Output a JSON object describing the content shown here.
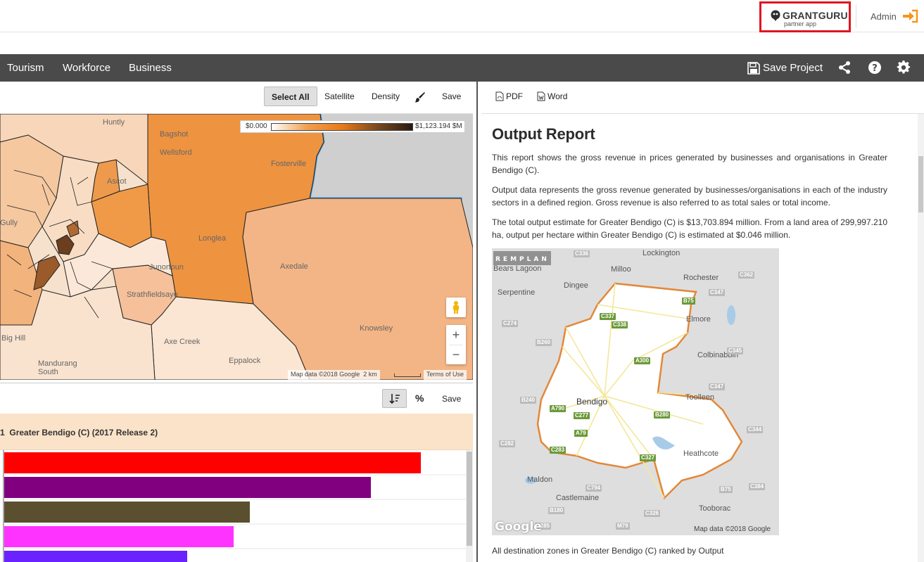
{
  "header": {
    "logo_name": "GRANTGURU",
    "logo_sub": "partner app",
    "user": "Admin",
    "brand_color": "#e0161e",
    "accent_color": "#f7941d"
  },
  "nav": {
    "items": [
      "Tourism",
      "Workforce",
      "Business"
    ],
    "save_project": "Save Project"
  },
  "map_toolbar": {
    "select_all": "Select All",
    "satellite": "Satellite",
    "density": "Density",
    "save": "Save"
  },
  "map": {
    "legend_min": "$0.000",
    "legend_max": "$1,123.194 $M",
    "places": [
      {
        "name": "Huntly"
      },
      {
        "name": "Bagshot"
      },
      {
        "name": "Wellsford"
      },
      {
        "name": "Fosterville"
      },
      {
        "name": "Gully"
      },
      {
        "name": "Longlea"
      },
      {
        "name": "Junortoun"
      },
      {
        "name": "Axedale"
      },
      {
        "name": "Strathfieldsaye"
      },
      {
        "name": "Knowsley"
      },
      {
        "name": "Axe Creek"
      },
      {
        "name": "Big Hill"
      },
      {
        "name": "Eppalock"
      },
      {
        "name": "Mandurang South"
      },
      {
        "name": "Ascot"
      }
    ],
    "attribution": "Map data ©2018 Google",
    "scale": "2 km",
    "terms": "Terms of Use"
  },
  "chart_toolbar": {
    "pct": "%",
    "save": "Save"
  },
  "chart_data": {
    "type": "bar",
    "title": "Greater Bendigo (C) (2017 Release 2)",
    "title_prefix": "1",
    "orientation": "horizontal",
    "series": [
      {
        "values": [
          1,
          0.88,
          0.59,
          0.55,
          0.44
        ],
        "colors": [
          "#ff0000",
          "#800080",
          "#5a5030",
          "#ff33ff",
          "#6a22ff"
        ]
      }
    ]
  },
  "doc_toolbar": {
    "pdf": "PDF",
    "word": "Word"
  },
  "report": {
    "title": "Output Report",
    "p1": "This report shows the gross revenue in prices generated by businesses and organisations in Greater Bendigo (C).",
    "p2": "Output data represents the gross revenue generated by businesses/organisations in each of the industry sectors in a defined region. Gross revenue is also referred to as total sales or total income.",
    "p3": "The total output estimate for Greater Bendigo (C) is $13,703.894 million. From a land area of 299,997.210 ha, output per hectare within Greater Bendigo (C) is estimated at $0.046 million.",
    "caption": "All  destination zones in Greater Bendigo (C) ranked by Output",
    "map_watermark": "REMPLAN",
    "map_attribution": "Map data ©2018 Google",
    "map_places": [
      "Lockington",
      "Bears Lagoon",
      "Milloo",
      "Rochester",
      "Serpentine",
      "Dingee",
      "Elmore",
      "Colbinabbin",
      "Bendigo",
      "Toolleen",
      "Heathcote",
      "Maldon",
      "Castlemaine",
      "Tooborac"
    ],
    "roads": [
      "C336",
      "C362",
      "C347",
      "B75",
      "C337",
      "C338",
      "C274",
      "B260",
      "A300",
      "C345",
      "B240",
      "A790",
      "C277",
      "B280",
      "C344",
      "C282",
      "A79",
      "C283",
      "C327",
      "C794",
      "B75",
      "C384",
      "B180",
      "C326",
      "C285",
      "M79",
      "C347"
    ]
  }
}
